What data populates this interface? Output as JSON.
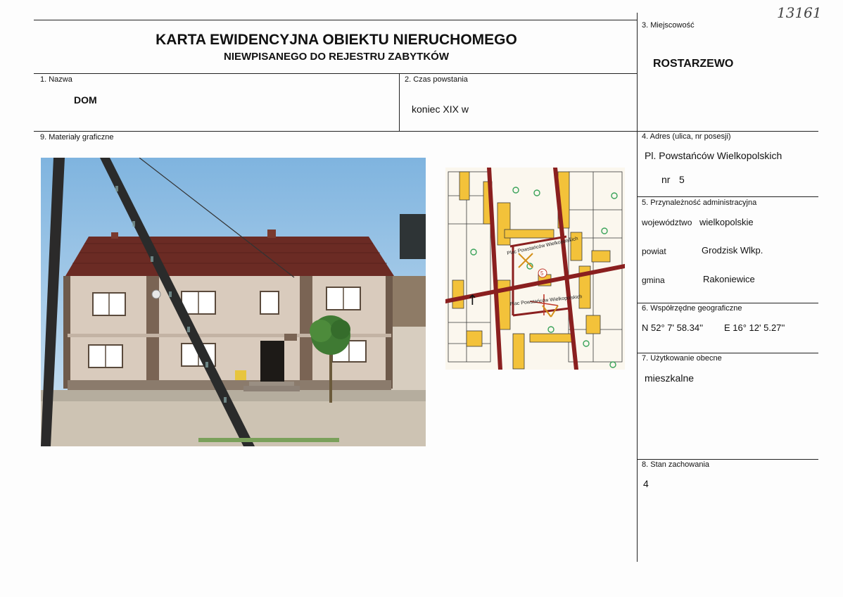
{
  "handwritten_number": "13161",
  "header": {
    "title": "KARTA EWIDENCYJNA OBIEKTU NIERUCHOMEGO",
    "subtitle": "NIEWPISANEGO DO REJESTRU ZABYTKÓW"
  },
  "fields": {
    "nazwa": {
      "label": "1. Nazwa",
      "value": "DOM"
    },
    "czas": {
      "label": "2. Czas powstania",
      "value": "koniec XIX w"
    },
    "miejscowosc": {
      "label": "3. Miejscowość",
      "value": "ROSTARZEWO"
    },
    "adres": {
      "label": "4. Adres (ulica, nr posesji)",
      "street": "Pl. Powstańców Wielkopolskich",
      "number_prefix": "nr",
      "number": "5"
    },
    "przynaleznosc": {
      "label": "5. Przynależność administracyjna",
      "wojewodztwo_label": "województwo",
      "wojewodztwo": "wielkopolskie",
      "powiat_label": "powiat",
      "powiat": "Grodzisk Wlkp.",
      "gmina_label": "gmina",
      "gmina": "Rakoniewice"
    },
    "wspolrzedne": {
      "label": "6. Współrzędne geograficzne",
      "n": "N  52° 7' 58.34''",
      "e": "E 16° 12' 5.27''"
    },
    "uzytkowanie": {
      "label": "7. Użytkowanie obecne",
      "value": "mieszkalne"
    },
    "stan": {
      "label": "8. Stan zachowania",
      "value": "4"
    },
    "materialy": {
      "label": "9. Materiały graficzne"
    }
  },
  "map_labels": {
    "street_upper": "Plac Powstańców Wielkopolskich",
    "street_lower": "Plac Powstańców Wielkopolskich",
    "plot_number": "5"
  },
  "colors": {
    "building_fill": "#f3c23a",
    "road": "#8a1f1f",
    "plot_line": "#c0392b",
    "tree": "#3aa35a"
  }
}
